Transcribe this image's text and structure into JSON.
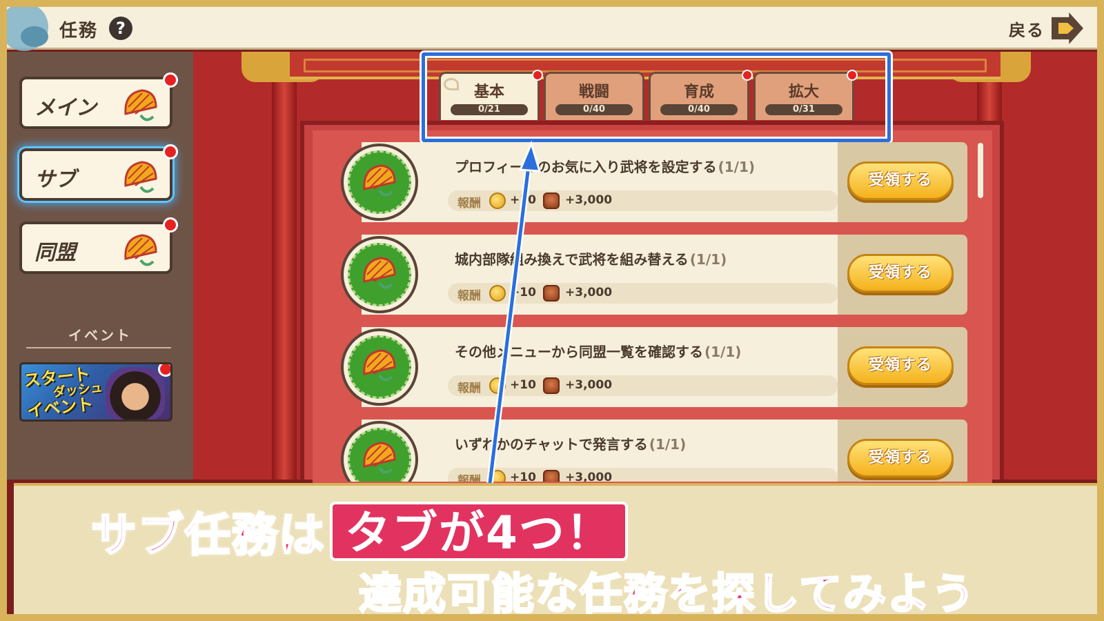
{
  "header": {
    "title": "任務",
    "help_icon": "question-icon",
    "back_label": "戻る",
    "back_icon": "arrow-right-icon"
  },
  "sidebar": {
    "items": [
      {
        "label": "メイン",
        "icon": "fan-icon",
        "badge": true,
        "active": false
      },
      {
        "label": "サブ",
        "icon": "fan-icon",
        "badge": true,
        "active": true
      },
      {
        "label": "同盟",
        "icon": "fan-icon",
        "badge": true,
        "active": false
      }
    ],
    "event_section_label": "イベント",
    "event_banner": {
      "text_line1": "スタート",
      "text_line2": "ダッシュ",
      "text_line3": "イベント",
      "badge": true
    }
  },
  "tabs": [
    {
      "label": "基本",
      "count": "0/21",
      "active": true,
      "badge": true
    },
    {
      "label": "戦闘",
      "count": "0/40",
      "active": false,
      "badge": false
    },
    {
      "label": "育成",
      "count": "0/40",
      "active": false,
      "badge": true
    },
    {
      "label": "拡大",
      "count": "0/31",
      "active": false,
      "badge": true
    }
  ],
  "missions": [
    {
      "title": "プロフィールのお気に入り武将を設定する",
      "progress": "(1/1)",
      "reward_label": "報酬",
      "coin_reward": "+10",
      "ration_reward": "+3,000",
      "button": "受領する"
    },
    {
      "title": "城内部隊組み換えで武将を組み替える",
      "progress": "(1/1)",
      "reward_label": "報酬",
      "coin_reward": "+10",
      "ration_reward": "+3,000",
      "button": "受領する"
    },
    {
      "title": "その他メニューから同盟一覧を確認する",
      "progress": "(1/1)",
      "reward_label": "報酬",
      "coin_reward": "+10",
      "ration_reward": "+3,000",
      "button": "受領する"
    },
    {
      "title": "いずれかのチャットで発言する",
      "progress": "(1/1)",
      "reward_label": "報酬",
      "coin_reward": "+10",
      "ration_reward": "+3,000",
      "button": "受領する"
    }
  ],
  "caption": {
    "line1_prefix": "サブ任務は",
    "line1_box": "タブが4つ！",
    "line2": "達成可能な任務を探してみよう"
  },
  "colors": {
    "highlight": "#2a6fdc",
    "badge": "#e52222",
    "caption_pink": "#e2336a",
    "mission_green": "#3fa02e",
    "claim_gold": "#f4b21c"
  }
}
